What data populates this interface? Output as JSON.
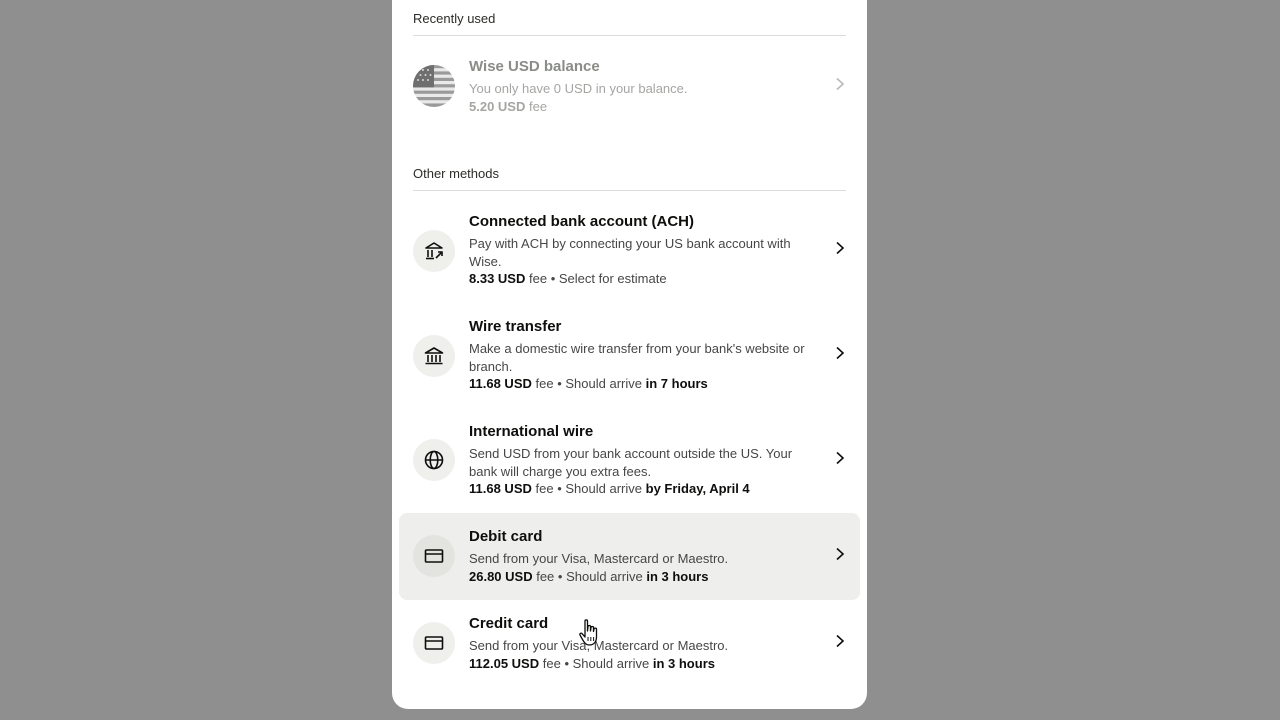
{
  "sections": {
    "recent_label": "Recently used",
    "other_label": "Other methods"
  },
  "recent": {
    "title": "Wise USD balance",
    "desc": "You only have 0 USD in your balance.",
    "fee_amount": "5.20 USD",
    "fee_word": "fee",
    "icon": "us-flag-icon",
    "state": "disabled"
  },
  "methods": [
    {
      "title": "Connected bank account (ACH)",
      "desc": "Pay with ACH by connecting your US bank account with Wise.",
      "fee_amount": "8.33 USD",
      "fee_word": "fee",
      "sep": "•",
      "eta_prefix": "Select for estimate",
      "eta_bold": "",
      "icon": "bank-connect-icon"
    },
    {
      "title": "Wire transfer",
      "desc": "Make a domestic wire transfer from your bank's website or branch.",
      "fee_amount": "11.68 USD",
      "fee_word": "fee",
      "sep": "•",
      "eta_prefix": "Should arrive",
      "eta_bold": "in 7 hours",
      "icon": "bank-icon"
    },
    {
      "title": "International wire",
      "desc": "Send USD from your bank account outside the US. Your bank will charge you extra fees.",
      "fee_amount": "11.68 USD",
      "fee_word": "fee",
      "sep": "•",
      "eta_prefix": "Should arrive",
      "eta_bold": "by Friday, April 4",
      "icon": "globe-icon"
    },
    {
      "title": "Debit card",
      "desc": "Send from your Visa, Mastercard or Maestro.",
      "fee_amount": "26.80 USD",
      "fee_word": "fee",
      "sep": "•",
      "eta_prefix": "Should arrive",
      "eta_bold": "in 3 hours",
      "icon": "card-icon",
      "state": "hovered"
    },
    {
      "title": "Credit card",
      "desc": "Send from your Visa, Mastercard or Maestro.",
      "fee_amount": "112.05 USD",
      "fee_word": "fee",
      "sep": "•",
      "eta_prefix": "Should arrive",
      "eta_bold": "in 3 hours",
      "icon": "card-icon"
    }
  ],
  "colors": {
    "backdrop": "#8f8f8f",
    "panel": "#ffffff",
    "hover_row": "#eeefec",
    "icon_bg": "#efefec",
    "text_primary": "#0e0f0c",
    "text_secondary": "#454745"
  }
}
